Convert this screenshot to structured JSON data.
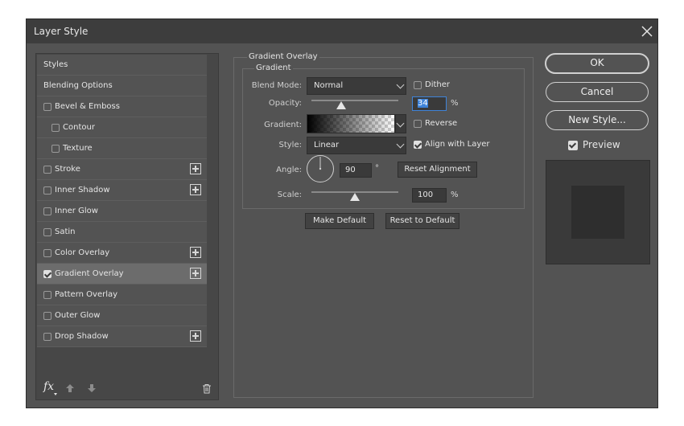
{
  "dialog": {
    "title": "Layer Style"
  },
  "styles_list": [
    {
      "label": "Styles",
      "checkbox": false,
      "checked": false,
      "plus": false,
      "indent": false,
      "selected": false
    },
    {
      "label": "Blending Options",
      "checkbox": false,
      "checked": false,
      "plus": false,
      "indent": false,
      "selected": false
    },
    {
      "label": "Bevel & Emboss",
      "checkbox": true,
      "checked": false,
      "plus": false,
      "indent": false,
      "selected": false
    },
    {
      "label": "Contour",
      "checkbox": true,
      "checked": false,
      "plus": false,
      "indent": true,
      "selected": false
    },
    {
      "label": "Texture",
      "checkbox": true,
      "checked": false,
      "plus": false,
      "indent": true,
      "selected": false
    },
    {
      "label": "Stroke",
      "checkbox": true,
      "checked": false,
      "plus": true,
      "indent": false,
      "selected": false
    },
    {
      "label": "Inner Shadow",
      "checkbox": true,
      "checked": false,
      "plus": true,
      "indent": false,
      "selected": false
    },
    {
      "label": "Inner Glow",
      "checkbox": true,
      "checked": false,
      "plus": false,
      "indent": false,
      "selected": false
    },
    {
      "label": "Satin",
      "checkbox": true,
      "checked": false,
      "plus": false,
      "indent": false,
      "selected": false
    },
    {
      "label": "Color Overlay",
      "checkbox": true,
      "checked": false,
      "plus": true,
      "indent": false,
      "selected": false
    },
    {
      "label": "Gradient Overlay",
      "checkbox": true,
      "checked": true,
      "plus": true,
      "indent": false,
      "selected": true
    },
    {
      "label": "Pattern Overlay",
      "checkbox": true,
      "checked": false,
      "plus": false,
      "indent": false,
      "selected": false
    },
    {
      "label": "Outer Glow",
      "checkbox": true,
      "checked": false,
      "plus": false,
      "indent": false,
      "selected": false
    },
    {
      "label": "Drop Shadow",
      "checkbox": true,
      "checked": false,
      "plus": true,
      "indent": false,
      "selected": false
    }
  ],
  "bottom_bar": {
    "fx_label": "fx"
  },
  "gradient_overlay": {
    "group_title": "Gradient Overlay",
    "subgroup_title": "Gradient",
    "blend_mode_label": "Blend Mode:",
    "blend_mode_value": "Normal",
    "dither_label": "Dither",
    "dither_checked": false,
    "opacity_label": "Opacity:",
    "opacity_value": "34",
    "opacity_unit": "%",
    "opacity_slider_fraction": 0.34,
    "gradient_label": "Gradient:",
    "reverse_label": "Reverse",
    "reverse_checked": false,
    "style_label": "Style:",
    "style_value": "Linear",
    "align_label": "Align with Layer",
    "align_checked": true,
    "angle_label": "Angle:",
    "angle_value": "90",
    "angle_unit": "°",
    "reset_alignment_label": "Reset Alignment",
    "scale_label": "Scale:",
    "scale_value": "100",
    "scale_unit": "%",
    "scale_slider_fraction": 0.5,
    "make_default_label": "Make Default",
    "reset_default_label": "Reset to Default"
  },
  "actions": {
    "ok_label": "OK",
    "cancel_label": "Cancel",
    "new_style_label": "New Style...",
    "preview_label": "Preview",
    "preview_checked": true
  },
  "colors": {
    "dialog_bg": "#535353",
    "titlebar_bg": "#3d3d3d",
    "selected_row": "#6c6c6c",
    "focus_accent": "#3f83d8",
    "preview_outer": "#3a3a3a",
    "preview_inner": "#2e2e2e"
  }
}
